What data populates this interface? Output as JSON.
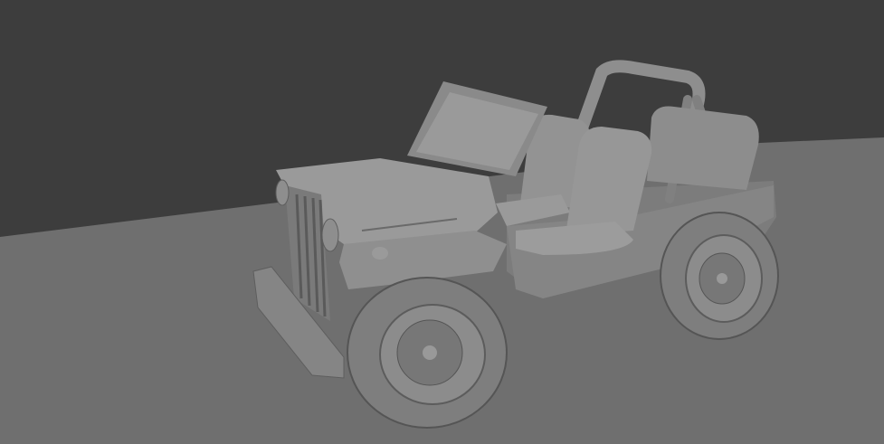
{
  "viewport": {
    "background_color": "#3d3d3d",
    "floor_color": "#6f6f6f",
    "model_color": "#8a8a8a",
    "model_shadow_color": "#5a5a5a",
    "model_highlight_color": "#a8a8a8",
    "model": "jeep"
  }
}
